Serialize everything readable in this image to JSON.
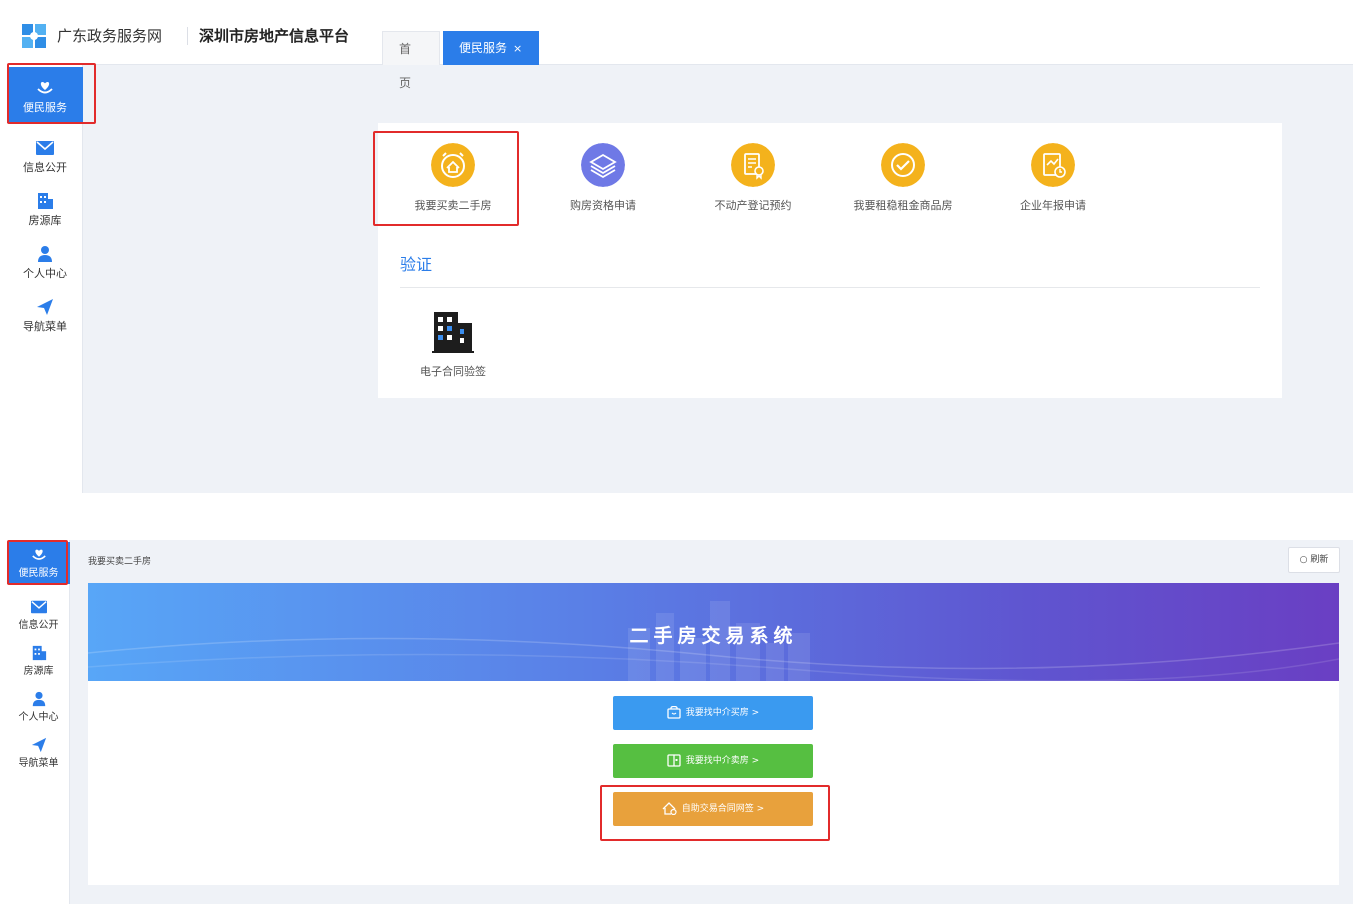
{
  "header": {
    "brand": "广东政务服务网",
    "platform": "深圳市房地产信息平台",
    "tabs": [
      {
        "label": "首 页"
      },
      {
        "label": "便民服务",
        "close": "×"
      }
    ]
  },
  "sidebar": {
    "items": [
      {
        "label": "便民服务",
        "icon": "heart-hand-icon"
      },
      {
        "label": "信息公开",
        "icon": "mail-icon"
      },
      {
        "label": "房源库",
        "icon": "building-icon"
      },
      {
        "label": "个人中心",
        "icon": "user-icon"
      },
      {
        "label": "导航菜单",
        "icon": "paper-plane-icon"
      }
    ]
  },
  "services": [
    {
      "label": "我要买卖二手房",
      "icon": "alarm-house-icon"
    },
    {
      "label": "购房资格申请",
      "icon": "layers-icon"
    },
    {
      "label": "不动产登记预约",
      "icon": "document-seal-icon"
    },
    {
      "label": "我要租稳租金商品房",
      "icon": "check-circle-icon"
    },
    {
      "label": "企业年报申请",
      "icon": "report-chart-icon"
    }
  ],
  "verify": {
    "title": "验证",
    "items": [
      {
        "label": "电子合同验签",
        "icon": "office-building-icon"
      }
    ]
  },
  "second": {
    "breadcrumb": "我要买卖二手房",
    "refresh": "刷新",
    "banner_title": "二手房交易系统",
    "buttons": [
      {
        "label": "我要找中介买房 >",
        "color": "#3a9af0"
      },
      {
        "label": "我要找中介卖房 >",
        "color": "#56bf41"
      },
      {
        "label": "自助交易合同网签 >",
        "color": "#e8a13c"
      }
    ]
  },
  "colors": {
    "accent": "#2b7de9",
    "highlight": "#e22b2b",
    "service_icon": "#f4b21c",
    "layers_icon": "#6f79e6"
  }
}
